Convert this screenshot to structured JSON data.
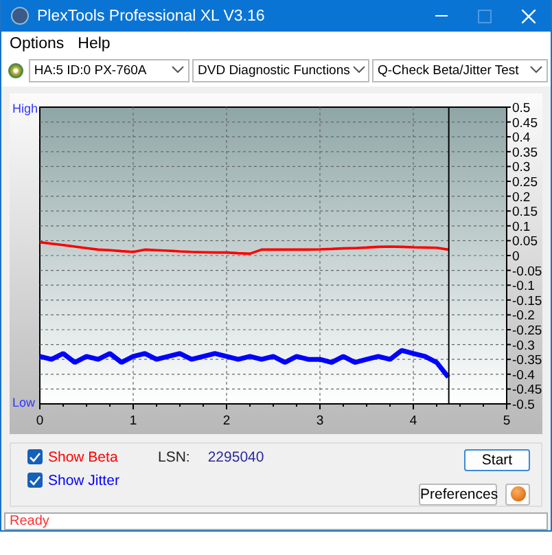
{
  "window": {
    "title": "PlexTools Professional XL V3.16"
  },
  "menu": [
    {
      "label": "Options"
    },
    {
      "label": "Help"
    }
  ],
  "toolbar": {
    "drive": "HA:5 ID:0  PX-760A",
    "function": "DVD Diagnostic Functions",
    "test": "Q-Check Beta/Jitter Test"
  },
  "chart": {
    "high_label": "High",
    "low_label": "Low",
    "chart_data": {
      "type": "line",
      "x": [
        0,
        0.125,
        0.25,
        0.375,
        0.5,
        0.625,
        0.75,
        0.875,
        1,
        1.125,
        1.25,
        1.375,
        1.5,
        1.625,
        1.75,
        1.875,
        2,
        2.125,
        2.25,
        2.375,
        2.5,
        2.625,
        2.75,
        2.875,
        3,
        3.125,
        3.25,
        3.375,
        3.5,
        3.625,
        3.75,
        3.875,
        4,
        4.125,
        4.25,
        4.375
      ],
      "series": [
        {
          "color": "#ff0000",
          "values": [
            0.045,
            0.04,
            0.035,
            0.03,
            0.025,
            0.02,
            0.018,
            0.015,
            0.012,
            0.02,
            0.018,
            0.016,
            0.014,
            0.012,
            0.011,
            0.01,
            0.01,
            0.008,
            0.006,
            0.02,
            0.02,
            0.02,
            0.02,
            0.02,
            0.021,
            0.022,
            0.024,
            0.025,
            0.027,
            0.029,
            0.03,
            0.029,
            0.028,
            0.027,
            0.026,
            0.02
          ]
        },
        {
          "color": "#0000ff",
          "values": [
            -0.34,
            -0.35,
            -0.33,
            -0.36,
            -0.34,
            -0.35,
            -0.33,
            -0.36,
            -0.34,
            -0.33,
            -0.35,
            -0.34,
            -0.33,
            -0.35,
            -0.34,
            -0.33,
            -0.34,
            -0.35,
            -0.34,
            -0.35,
            -0.34,
            -0.36,
            -0.34,
            -0.35,
            -0.35,
            -0.36,
            -0.34,
            -0.36,
            -0.35,
            -0.34,
            -0.35,
            -0.32,
            -0.33,
            -0.34,
            -0.36,
            -0.41
          ]
        }
      ],
      "xlim": [
        0,
        5
      ],
      "ylim": [
        -0.5,
        0.5
      ],
      "xticks": [
        0,
        1,
        2,
        3,
        4,
        5
      ],
      "yticks": [
        0.5,
        0.45,
        0.4,
        0.35,
        0.3,
        0.25,
        0.2,
        0.15,
        0.1,
        0.05,
        0,
        -0.05,
        -0.1,
        -0.15,
        -0.2,
        -0.25,
        -0.3,
        -0.35,
        -0.4,
        -0.45,
        -0.5
      ],
      "grid": true,
      "ref_lines": [
        {
          "axis": "x",
          "value": 4.38
        }
      ]
    }
  },
  "controls": {
    "checkboxes": [
      {
        "label": "Show Beta",
        "checked": true,
        "color": "#ff0000"
      },
      {
        "label": "Show Jitter",
        "checked": true,
        "color": "#0000ff"
      }
    ],
    "lsn_label": "LSN:",
    "lsn_value": "2295040",
    "buttons": [
      {
        "label": "Start",
        "kind": "primary"
      },
      {
        "label": "Preferences",
        "kind": "normal"
      }
    ]
  },
  "status_bar": {
    "text": "Ready"
  }
}
